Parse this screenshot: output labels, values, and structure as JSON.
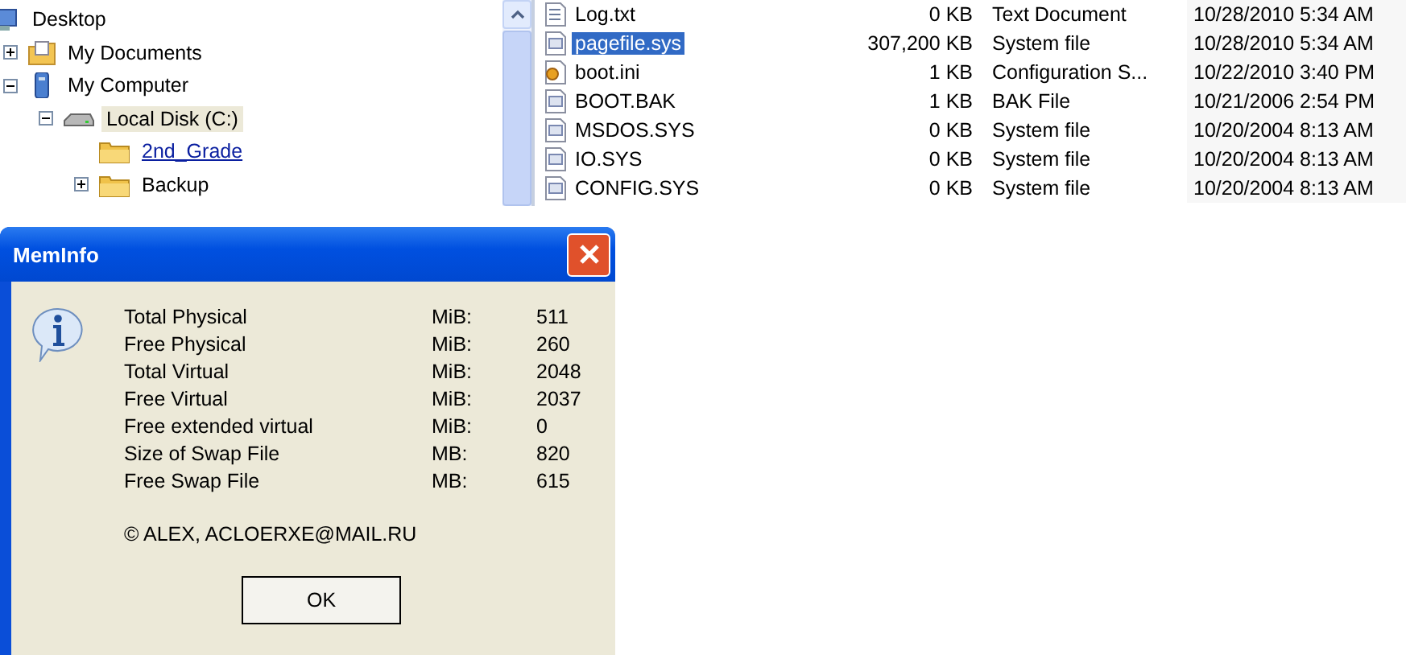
{
  "tree": [
    {
      "label": "Desktop",
      "kind": "desktop",
      "selected": false,
      "hovered": false,
      "children": [
        {
          "label": "My Documents",
          "kind": "documents",
          "expanded": false,
          "selected": false,
          "hovered": false
        },
        {
          "label": "My Computer",
          "kind": "computer",
          "expanded": true,
          "selected": false,
          "hovered": false,
          "children": [
            {
              "label": "Local Disk (C:)",
              "kind": "drive",
              "expanded": true,
              "selected": true,
              "hovered": false,
              "children": [
                {
                  "label": "2nd_Grade",
                  "kind": "folder",
                  "selected": false,
                  "hovered": true
                },
                {
                  "label": "Backup",
                  "kind": "folder",
                  "expanded": false,
                  "selected": false,
                  "hovered": false
                }
              ]
            }
          ]
        }
      ]
    }
  ],
  "files": [
    {
      "name": "Log.txt",
      "kind": "text",
      "size": "0 KB",
      "type": "Text Document",
      "modified": "10/28/2010 5:34 AM",
      "selected": false
    },
    {
      "name": "pagefile.sys",
      "kind": "system",
      "size": "307,200 KB",
      "type": "System file",
      "modified": "10/28/2010 5:34 AM",
      "selected": true
    },
    {
      "name": "boot.ini",
      "kind": "config",
      "size": "1 KB",
      "type": "Configuration S...",
      "modified": "10/22/2010 3:40 PM",
      "selected": false
    },
    {
      "name": "BOOT.BAK",
      "kind": "system",
      "size": "1 KB",
      "type": "BAK File",
      "modified": "10/21/2006 2:54 PM",
      "selected": false
    },
    {
      "name": "MSDOS.SYS",
      "kind": "system",
      "size": "0 KB",
      "type": "System file",
      "modified": "10/20/2004 8:13 AM",
      "selected": false
    },
    {
      "name": "IO.SYS",
      "kind": "system",
      "size": "0 KB",
      "type": "System file",
      "modified": "10/20/2004 8:13 AM",
      "selected": false
    },
    {
      "name": "CONFIG.SYS",
      "kind": "system",
      "size": "0 KB",
      "type": "System file",
      "modified": "10/20/2004 8:13 AM",
      "selected": false
    }
  ],
  "dialog": {
    "title": "MemInfo",
    "rows": [
      {
        "label": "Total Physical",
        "unit": "MiB:",
        "value": "511"
      },
      {
        "label": "Free Physical",
        "unit": "MiB:",
        "value": "260"
      },
      {
        "label": "Total Virtual",
        "unit": "MiB:",
        "value": "2048"
      },
      {
        "label": "Free Virtual",
        "unit": "MiB:",
        "value": "2037"
      },
      {
        "label": "Free extended virtual",
        "unit": "MiB:",
        "value": "0"
      },
      {
        "label": "Size of Swap File",
        "unit": "MB:",
        "value": "820"
      },
      {
        "label": "Free Swap File",
        "unit": "MB:",
        "value": "615"
      }
    ],
    "copyright": "© ALEX, ACLOERXE@MAIL.RU",
    "button": "OK"
  }
}
